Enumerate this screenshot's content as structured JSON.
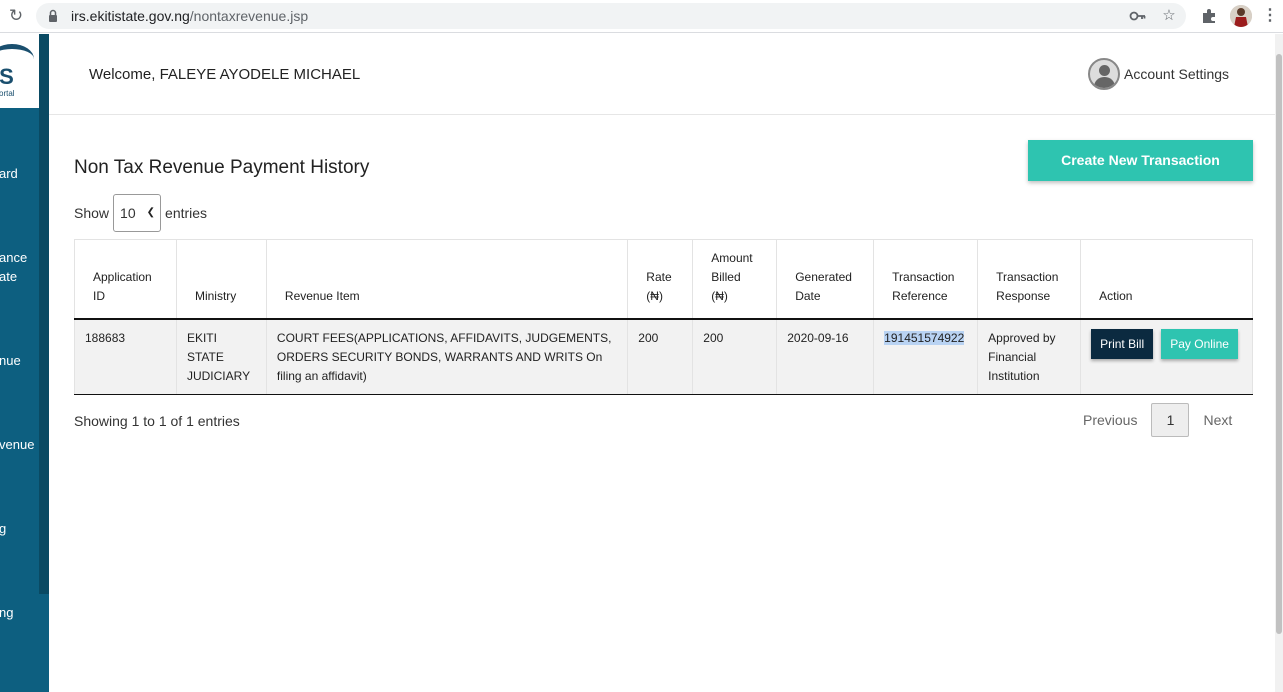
{
  "browser": {
    "url_host": "irs.ekitistate.gov.ng",
    "url_path": "/nontaxrevenue.jsp"
  },
  "sidebar": {
    "logo_text": "IS",
    "logo_sub": "ortal",
    "items": [
      {
        "label": "ard"
      },
      {
        "label": "ance"
      },
      {
        "label": "ate"
      },
      {
        "label": "nue"
      },
      {
        "label": "venue"
      },
      {
        "label": "g"
      },
      {
        "label": "ng"
      }
    ]
  },
  "header": {
    "welcome": "Welcome, FALEYE AYODELE MICHAEL",
    "account_settings": "Account Settings"
  },
  "main": {
    "title": "Non Tax Revenue Payment History",
    "create_button": "Create New Transaction",
    "show_label": "Show",
    "entries_label": "entries",
    "page_length": "10",
    "columns": [
      {
        "line1": "Application",
        "line2": "ID"
      },
      {
        "line1": "",
        "line2": "Ministry"
      },
      {
        "line1": "",
        "line2": "Revenue Item"
      },
      {
        "line1": "Rate",
        "line2": "(₦)"
      },
      {
        "line1": "Amount",
        "line2": "Billed",
        "line3": "(₦)"
      },
      {
        "line1": "Generated",
        "line2": "Date"
      },
      {
        "line1": "Transaction",
        "line2": "Reference"
      },
      {
        "line1": "Transaction",
        "line2": "Response"
      },
      {
        "line1": "",
        "line2": "Action"
      }
    ],
    "rows": [
      {
        "application_id": "188683",
        "ministry": "EKITI STATE JUDICIARY",
        "revenue_item": "COURT FEES(APPLICATIONS, AFFIDAVITS, JUDGEMENTS, ORDERS SECURITY BONDS, WARRANTS AND WRITS On filing an affidavit)",
        "rate": "200",
        "amount_billed": "200",
        "generated_date": "2020-09-16",
        "transaction_reference": "191451574922",
        "transaction_response": "Approved by Financial Institution",
        "print_label": "Print Bill",
        "pay_label": "Pay Online"
      }
    ],
    "info": "Showing 1 to 1 of 1 entries",
    "pager": {
      "previous": "Previous",
      "current_page": "1",
      "next": "Next"
    }
  },
  "colors": {
    "sidebar": "#0d5f80",
    "accent": "#2ec4b0",
    "dark_button": "#0b2a40"
  }
}
